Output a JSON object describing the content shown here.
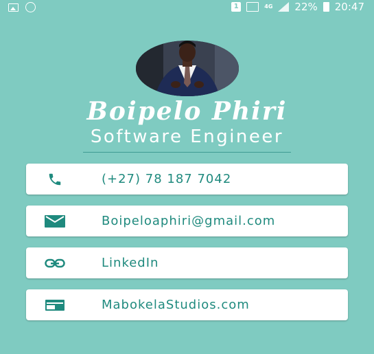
{
  "status_bar": {
    "sim_label": "1",
    "network_label": "4G",
    "battery": "22%",
    "time": "20:47"
  },
  "profile": {
    "name": "Boipelo Phiri",
    "title": "Software Engineer"
  },
  "contacts": [
    {
      "icon": "phone-icon",
      "label": "(+27) 78 187 7042"
    },
    {
      "icon": "email-icon",
      "label": "Boipeloaphiri@gmail.com"
    },
    {
      "icon": "link-icon",
      "label": "LinkedIn"
    },
    {
      "icon": "web-icon",
      "label": "MabokelaStudios.com"
    }
  ],
  "colors": {
    "background": "#7fcbc1",
    "accent": "#1f8a7e",
    "card": "#ffffff"
  }
}
